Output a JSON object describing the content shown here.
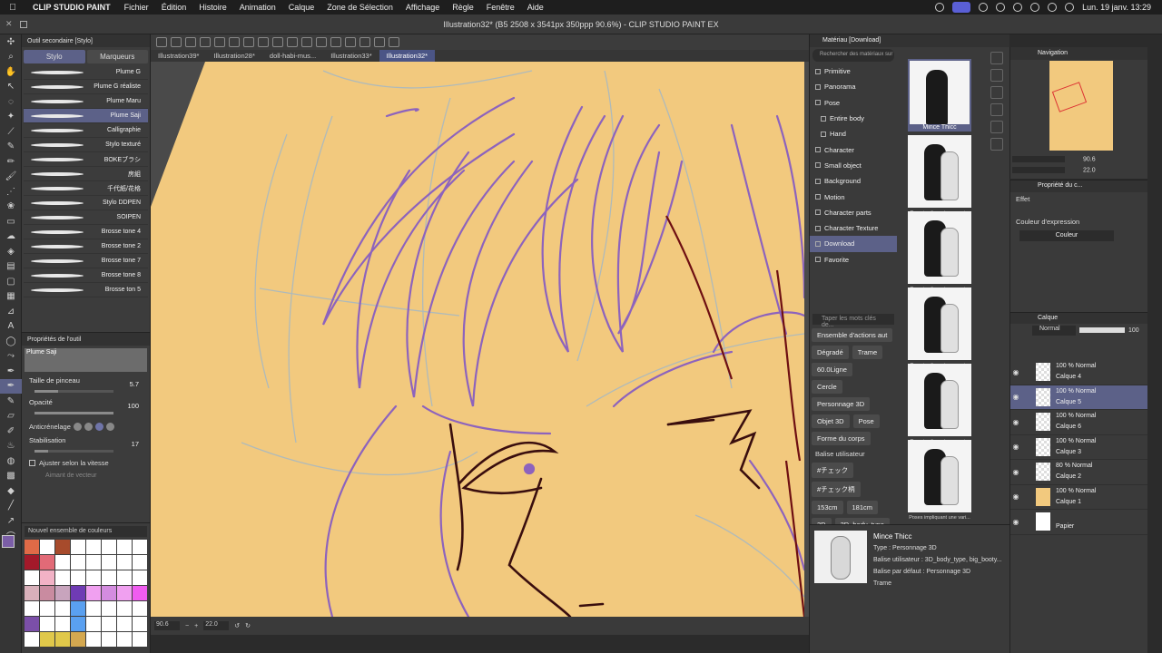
{
  "menubar": {
    "app_name": "CLIP STUDIO PAINT",
    "items": [
      "Fichier",
      "Édition",
      "Histoire",
      "Animation",
      "Calque",
      "Zone de Sélection",
      "Affichage",
      "Règle",
      "Fenêtre",
      "Aide"
    ],
    "clock": "Lun. 19 janv. 13:29"
  },
  "window": {
    "title": "Illustration32* (B5 2508 x 3541px 350ppp 90.6%) - CLIP STUDIO PAINT EX"
  },
  "subtool": {
    "header": "Outil secondaire [Stylo]",
    "groups": [
      "Stylo",
      "Marqueurs"
    ],
    "brushes": [
      "Plume G",
      "Plume G réaliste",
      "Plume Maru",
      "Plume Saji",
      "Calligraphie",
      "Stylo texturé",
      "BOKEブラシ",
      "房組",
      "千代紙/花格",
      "Stylo DDPEN",
      "SOIPEN",
      "Brosse tone 4",
      "Brosse tone 2",
      "Brosse tone 7",
      "Brosse tone 8",
      "Brosse ton 5"
    ],
    "selected_index": 3
  },
  "tool_property": {
    "header": "Propriétés de l'outil",
    "preview_name": "Plume Saji",
    "brush_size_label": "Taille de pinceau",
    "brush_size_value": "5.7",
    "opacity_label": "Opacité",
    "opacity_value": "100",
    "antialias_label": "Anticrénelage",
    "stabilization_label": "Stabilisation",
    "stabilization_value": "17",
    "speed_label": "Ajuster selon la vitesse",
    "vector_label": "Aimant de vecteur"
  },
  "colorset": {
    "name": "Nouvel ensemble de couleurs",
    "swatches": [
      "#e06a47",
      "#fff",
      "#a74b2c",
      "#fff",
      "#fff",
      "#fff",
      "#fff",
      "#fff",
      "#a3192a",
      "#e26a77",
      "#fff",
      "#fff",
      "#fff",
      "#fff",
      "#fff",
      "#fff",
      "#fff",
      "#f2b2c6",
      "#fff",
      "#fff",
      "#fff",
      "#fff",
      "#fff",
      "#fff",
      "#d8b0ba",
      "#c98ba0",
      "#c8a4bd",
      "#6f3bb4",
      "#f0a0f0",
      "#d48ce0",
      "#f0a0f0",
      "#f05cf0",
      "#fff",
      "#fff",
      "#fff",
      "#5aa0f0",
      "#fff",
      "#fff",
      "#fff",
      "#fff",
      "#7b4fa8",
      "#fff",
      "#fff",
      "#5aa0f0",
      "#fff",
      "#fff",
      "#fff",
      "#fff",
      "#fff",
      "#e0c84a",
      "#e0c84a",
      "#d4a850",
      "#fff",
      "#fff",
      "#fff",
      "#fff"
    ],
    "main_color": "#7b5ea7",
    "sub_color": "#a3192a"
  },
  "canvas": {
    "tabs": [
      "Illustration39*",
      "Illustration28*",
      "doll-habi-mus...",
      "Illustration33*",
      "Illustration32*"
    ],
    "selected_tab": 4,
    "zoom": "90.6",
    "rotation": "22.0",
    "colors": {
      "background": "#f2c97e",
      "purple_line": "#8d63bd",
      "sketch": "#9fb7c9",
      "dark_line": "#3a0e0e",
      "red_line": "#6e0f12"
    }
  },
  "material": {
    "header": "Matériau [Download]",
    "search_placeholder": "Rechercher des matériaux sur",
    "tree": [
      "Primitive",
      "Panorama",
      "Pose",
      "Entire body",
      "Hand",
      "Character",
      "Small object",
      "Background",
      "Motion",
      "Character parts",
      "Character Texture",
      "Download",
      "Favorite"
    ],
    "tree_selected": 11,
    "tag_placeholder": "Taper les mots clés de...",
    "tag_rows": [
      [
        "Ensemble d'actions aut"
      ],
      [
        "Dégradé",
        "Trame"
      ],
      [
        "60.0Ligne"
      ],
      [
        "Cercle"
      ],
      [
        "Personnage 3D"
      ],
      [
        "Objet 3D",
        "Pose"
      ],
      [
        "Forme du corps"
      ]
    ],
    "tags_label": "Balise utilisateur",
    "user_tags": [
      [
        "#チェック"
      ],
      [
        "#チェック柄"
      ],
      [
        "153cm",
        "181cm"
      ],
      [
        "3D",
        "3D_body_type"
      ]
    ],
    "thumbs": [
      "Mince Thicc",
      "Pose impliquant une vari...",
      "Pose impliquant une vari...",
      "Pose impliquant une vari...",
      "Pose impliquant une vari...",
      "Poses impliquant une vari..."
    ],
    "detail": {
      "title": "Mince Thicc",
      "type": "Type : Personnage 3D",
      "user_tag": "Balise utilisateur : 3D_body_type, big_booty...",
      "default_tag": "Balise par défaut : Personnage 3D",
      "trame": "Trame"
    }
  },
  "navigator": {
    "header": "Navigation",
    "zoom": "90.6",
    "rotation": "22.0"
  },
  "layer_property": {
    "header": "Propriété du c...",
    "effect": "Effet",
    "expr_label": "Couleur d'expression",
    "expr_value": "Couleur"
  },
  "layers": {
    "header": "Calque",
    "blend_mode": "Normal",
    "opacity": "100",
    "items": [
      {
        "blend": "100 % Normal",
        "name": "Calque 4",
        "thumb": "transparent"
      },
      {
        "blend": "100 % Normal",
        "name": "Calque 5",
        "thumb": "transparent"
      },
      {
        "blend": "100 % Normal",
        "name": "Calque 6",
        "thumb": "transparent"
      },
      {
        "blend": "100 % Normal",
        "name": "Calque 3",
        "thumb": "transparent"
      },
      {
        "blend": "80 % Normal",
        "name": "Calque 2",
        "thumb": "transparent"
      },
      {
        "blend": "100 % Normal",
        "name": "Calque 1",
        "thumb": "fill"
      },
      {
        "blend": "",
        "name": "Papier",
        "thumb": "white"
      }
    ],
    "selected_index": 1
  }
}
